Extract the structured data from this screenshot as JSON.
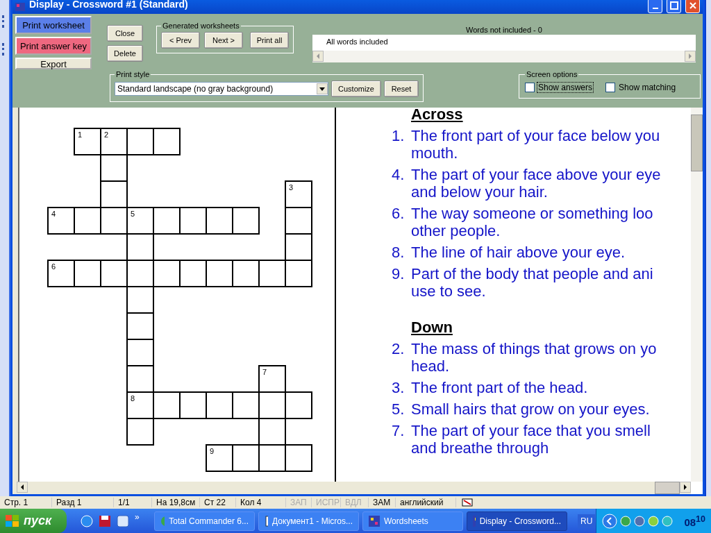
{
  "window": {
    "title": "Display - Crossword #1 (Standard)"
  },
  "actions": [
    {
      "label": "Print worksheet",
      "kind": "primary"
    },
    {
      "label": "Print answer key",
      "kind": "answer"
    },
    {
      "label": "Export",
      "kind": "plain"
    }
  ],
  "buttons": [
    "Close",
    "Delete"
  ],
  "generated_worksheets": {
    "title": "Generated worksheets",
    "buttons": [
      "< Prev",
      "Next >",
      "Print all"
    ]
  },
  "words_not_included": {
    "title": "Words not included - 0",
    "items": [
      "All words included"
    ]
  },
  "print_style": {
    "title": "Print style",
    "value": "Standard landscape (no gray background)",
    "buttons": [
      "Customize",
      "Reset"
    ]
  },
  "screen_options": {
    "title": "Screen options",
    "options": [
      {
        "label": "Show answers",
        "checked": false,
        "focused": true
      },
      {
        "label": "Show matching",
        "checked": false,
        "focused": false
      }
    ]
  },
  "crossword": {
    "rows": [
      [
        {
          "kind": "blank"
        },
        {
          "kind": "letter",
          "number": "1"
        },
        {
          "kind": "letter",
          "number": "2"
        },
        {
          "kind": "letter"
        },
        {
          "kind": "letter"
        },
        {
          "kind": "blank"
        },
        {
          "kind": "blank"
        },
        {
          "kind": "blank"
        },
        {
          "kind": "blank"
        },
        {
          "kind": "blank"
        }
      ],
      [
        {
          "kind": "blank"
        },
        {
          "kind": "blank"
        },
        {
          "kind": "letter"
        },
        {
          "kind": "blank"
        },
        {
          "kind": "blank"
        },
        {
          "kind": "blank"
        },
        {
          "kind": "blank"
        },
        {
          "kind": "blank"
        },
        {
          "kind": "blank"
        },
        {
          "kind": "blank"
        }
      ],
      [
        {
          "kind": "blank"
        },
        {
          "kind": "blank"
        },
        {
          "kind": "letter"
        },
        {
          "kind": "blank"
        },
        {
          "kind": "blank"
        },
        {
          "kind": "blank"
        },
        {
          "kind": "blank"
        },
        {
          "kind": "blank"
        },
        {
          "kind": "blank"
        },
        {
          "kind": "letter",
          "number": "3"
        }
      ],
      [
        {
          "kind": "letter",
          "number": "4"
        },
        {
          "kind": "letter"
        },
        {
          "kind": "letter"
        },
        {
          "kind": "letter",
          "number": "5"
        },
        {
          "kind": "letter"
        },
        {
          "kind": "letter"
        },
        {
          "kind": "letter"
        },
        {
          "kind": "letter"
        },
        {
          "kind": "blank"
        },
        {
          "kind": "letter"
        }
      ],
      [
        {
          "kind": "blank"
        },
        {
          "kind": "blank"
        },
        {
          "kind": "blank"
        },
        {
          "kind": "letter"
        },
        {
          "kind": "blank"
        },
        {
          "kind": "blank"
        },
        {
          "kind": "blank"
        },
        {
          "kind": "blank"
        },
        {
          "kind": "blank"
        },
        {
          "kind": "letter"
        }
      ],
      [
        {
          "kind": "letter",
          "number": "6"
        },
        {
          "kind": "letter"
        },
        {
          "kind": "letter"
        },
        {
          "kind": "letter"
        },
        {
          "kind": "letter"
        },
        {
          "kind": "letter"
        },
        {
          "kind": "letter"
        },
        {
          "kind": "letter"
        },
        {
          "kind": "letter"
        },
        {
          "kind": "letter"
        }
      ],
      [
        {
          "kind": "blank"
        },
        {
          "kind": "blank"
        },
        {
          "kind": "blank"
        },
        {
          "kind": "letter"
        },
        {
          "kind": "blank"
        },
        {
          "kind": "blank"
        },
        {
          "kind": "blank"
        },
        {
          "kind": "blank"
        },
        {
          "kind": "blank"
        },
        {
          "kind": "blank"
        }
      ],
      [
        {
          "kind": "blank"
        },
        {
          "kind": "blank"
        },
        {
          "kind": "blank"
        },
        {
          "kind": "letter"
        },
        {
          "kind": "blank"
        },
        {
          "kind": "blank"
        },
        {
          "kind": "blank"
        },
        {
          "kind": "blank"
        },
        {
          "kind": "blank"
        },
        {
          "kind": "blank"
        }
      ],
      [
        {
          "kind": "blank"
        },
        {
          "kind": "blank"
        },
        {
          "kind": "blank"
        },
        {
          "kind": "letter"
        },
        {
          "kind": "blank"
        },
        {
          "kind": "blank"
        },
        {
          "kind": "blank"
        },
        {
          "kind": "blank"
        },
        {
          "kind": "blank"
        },
        {
          "kind": "blank"
        }
      ],
      [
        {
          "kind": "blank"
        },
        {
          "kind": "blank"
        },
        {
          "kind": "blank"
        },
        {
          "kind": "letter"
        },
        {
          "kind": "blank"
        },
        {
          "kind": "blank"
        },
        {
          "kind": "blank"
        },
        {
          "kind": "blank"
        },
        {
          "kind": "letter",
          "number": "7"
        },
        {
          "kind": "blank"
        }
      ],
      [
        {
          "kind": "blank"
        },
        {
          "kind": "blank"
        },
        {
          "kind": "blank"
        },
        {
          "kind": "letter",
          "number": "8"
        },
        {
          "kind": "letter"
        },
        {
          "kind": "letter"
        },
        {
          "kind": "letter"
        },
        {
          "kind": "letter"
        },
        {
          "kind": "letter"
        },
        {
          "kind": "letter"
        }
      ],
      [
        {
          "kind": "blank"
        },
        {
          "kind": "blank"
        },
        {
          "kind": "blank"
        },
        {
          "kind": "letter"
        },
        {
          "kind": "blank"
        },
        {
          "kind": "blank"
        },
        {
          "kind": "blank"
        },
        {
          "kind": "blank"
        },
        {
          "kind": "letter"
        },
        {
          "kind": "blank"
        }
      ],
      [
        {
          "kind": "blank"
        },
        {
          "kind": "blank"
        },
        {
          "kind": "blank"
        },
        {
          "kind": "blank"
        },
        {
          "kind": "blank"
        },
        {
          "kind": "blank"
        },
        {
          "kind": "letter",
          "number": "9"
        },
        {
          "kind": "letter"
        },
        {
          "kind": "letter"
        },
        {
          "kind": "letter"
        }
      ]
    ]
  },
  "clues": [
    {
      "heading": "Across",
      "items": [
        {
          "number": "1.",
          "lines": [
            "The front part of your face below you",
            "mouth."
          ]
        },
        {
          "number": "4.",
          "lines": [
            "The part of your face above your eye",
            "and below your hair."
          ]
        },
        {
          "number": "6.",
          "lines": [
            "The way someone or something loo",
            "other people."
          ]
        },
        {
          "number": "8.",
          "lines": [
            "The line of hair above your eye."
          ]
        },
        {
          "number": "9.",
          "lines": [
            "Part of the body that people and ani",
            "use to see."
          ]
        }
      ]
    },
    {
      "heading": "Down",
      "items": [
        {
          "number": "2.",
          "lines": [
            "The mass of things that grows on yo",
            "head."
          ]
        },
        {
          "number": "3.",
          "lines": [
            "The front part of the head."
          ]
        },
        {
          "number": "5.",
          "lines": [
            "Small hairs that grow on your eyes."
          ]
        },
        {
          "number": "7.",
          "lines": [
            "The part of your face that you smell",
            "and breathe through"
          ]
        }
      ]
    }
  ],
  "word_status_bar": [
    {
      "text": "Стр. 1",
      "disabled": false
    },
    {
      "text": "Разд 1",
      "disabled": false
    },
    {
      "text": "1/1",
      "disabled": false
    },
    {
      "text": "На 19,8см",
      "disabled": false
    },
    {
      "text": "Ст 22",
      "disabled": false
    },
    {
      "text": "Кол 4",
      "disabled": false
    },
    {
      "text": "ЗАП",
      "disabled": true
    },
    {
      "text": "ИСПР",
      "disabled": true
    },
    {
      "text": "ВДЛ",
      "disabled": true
    },
    {
      "text": "ЗАМ",
      "disabled": false
    },
    {
      "text": "английский",
      "disabled": false
    }
  ],
  "taskbar": {
    "start": "пуск",
    "more": "»",
    "tasks": [
      {
        "label": "Total Commander 6...",
        "kind": "commander",
        "selected": false
      },
      {
        "label": "Документ1 - Micros...",
        "kind": "word",
        "selected": false
      },
      {
        "label": "Wordsheets",
        "kind": "app",
        "selected": false
      },
      {
        "label": "Display - Crossword...",
        "kind": "app",
        "selected": true
      }
    ],
    "language": "RU",
    "clock": "08$^{10}$"
  }
}
